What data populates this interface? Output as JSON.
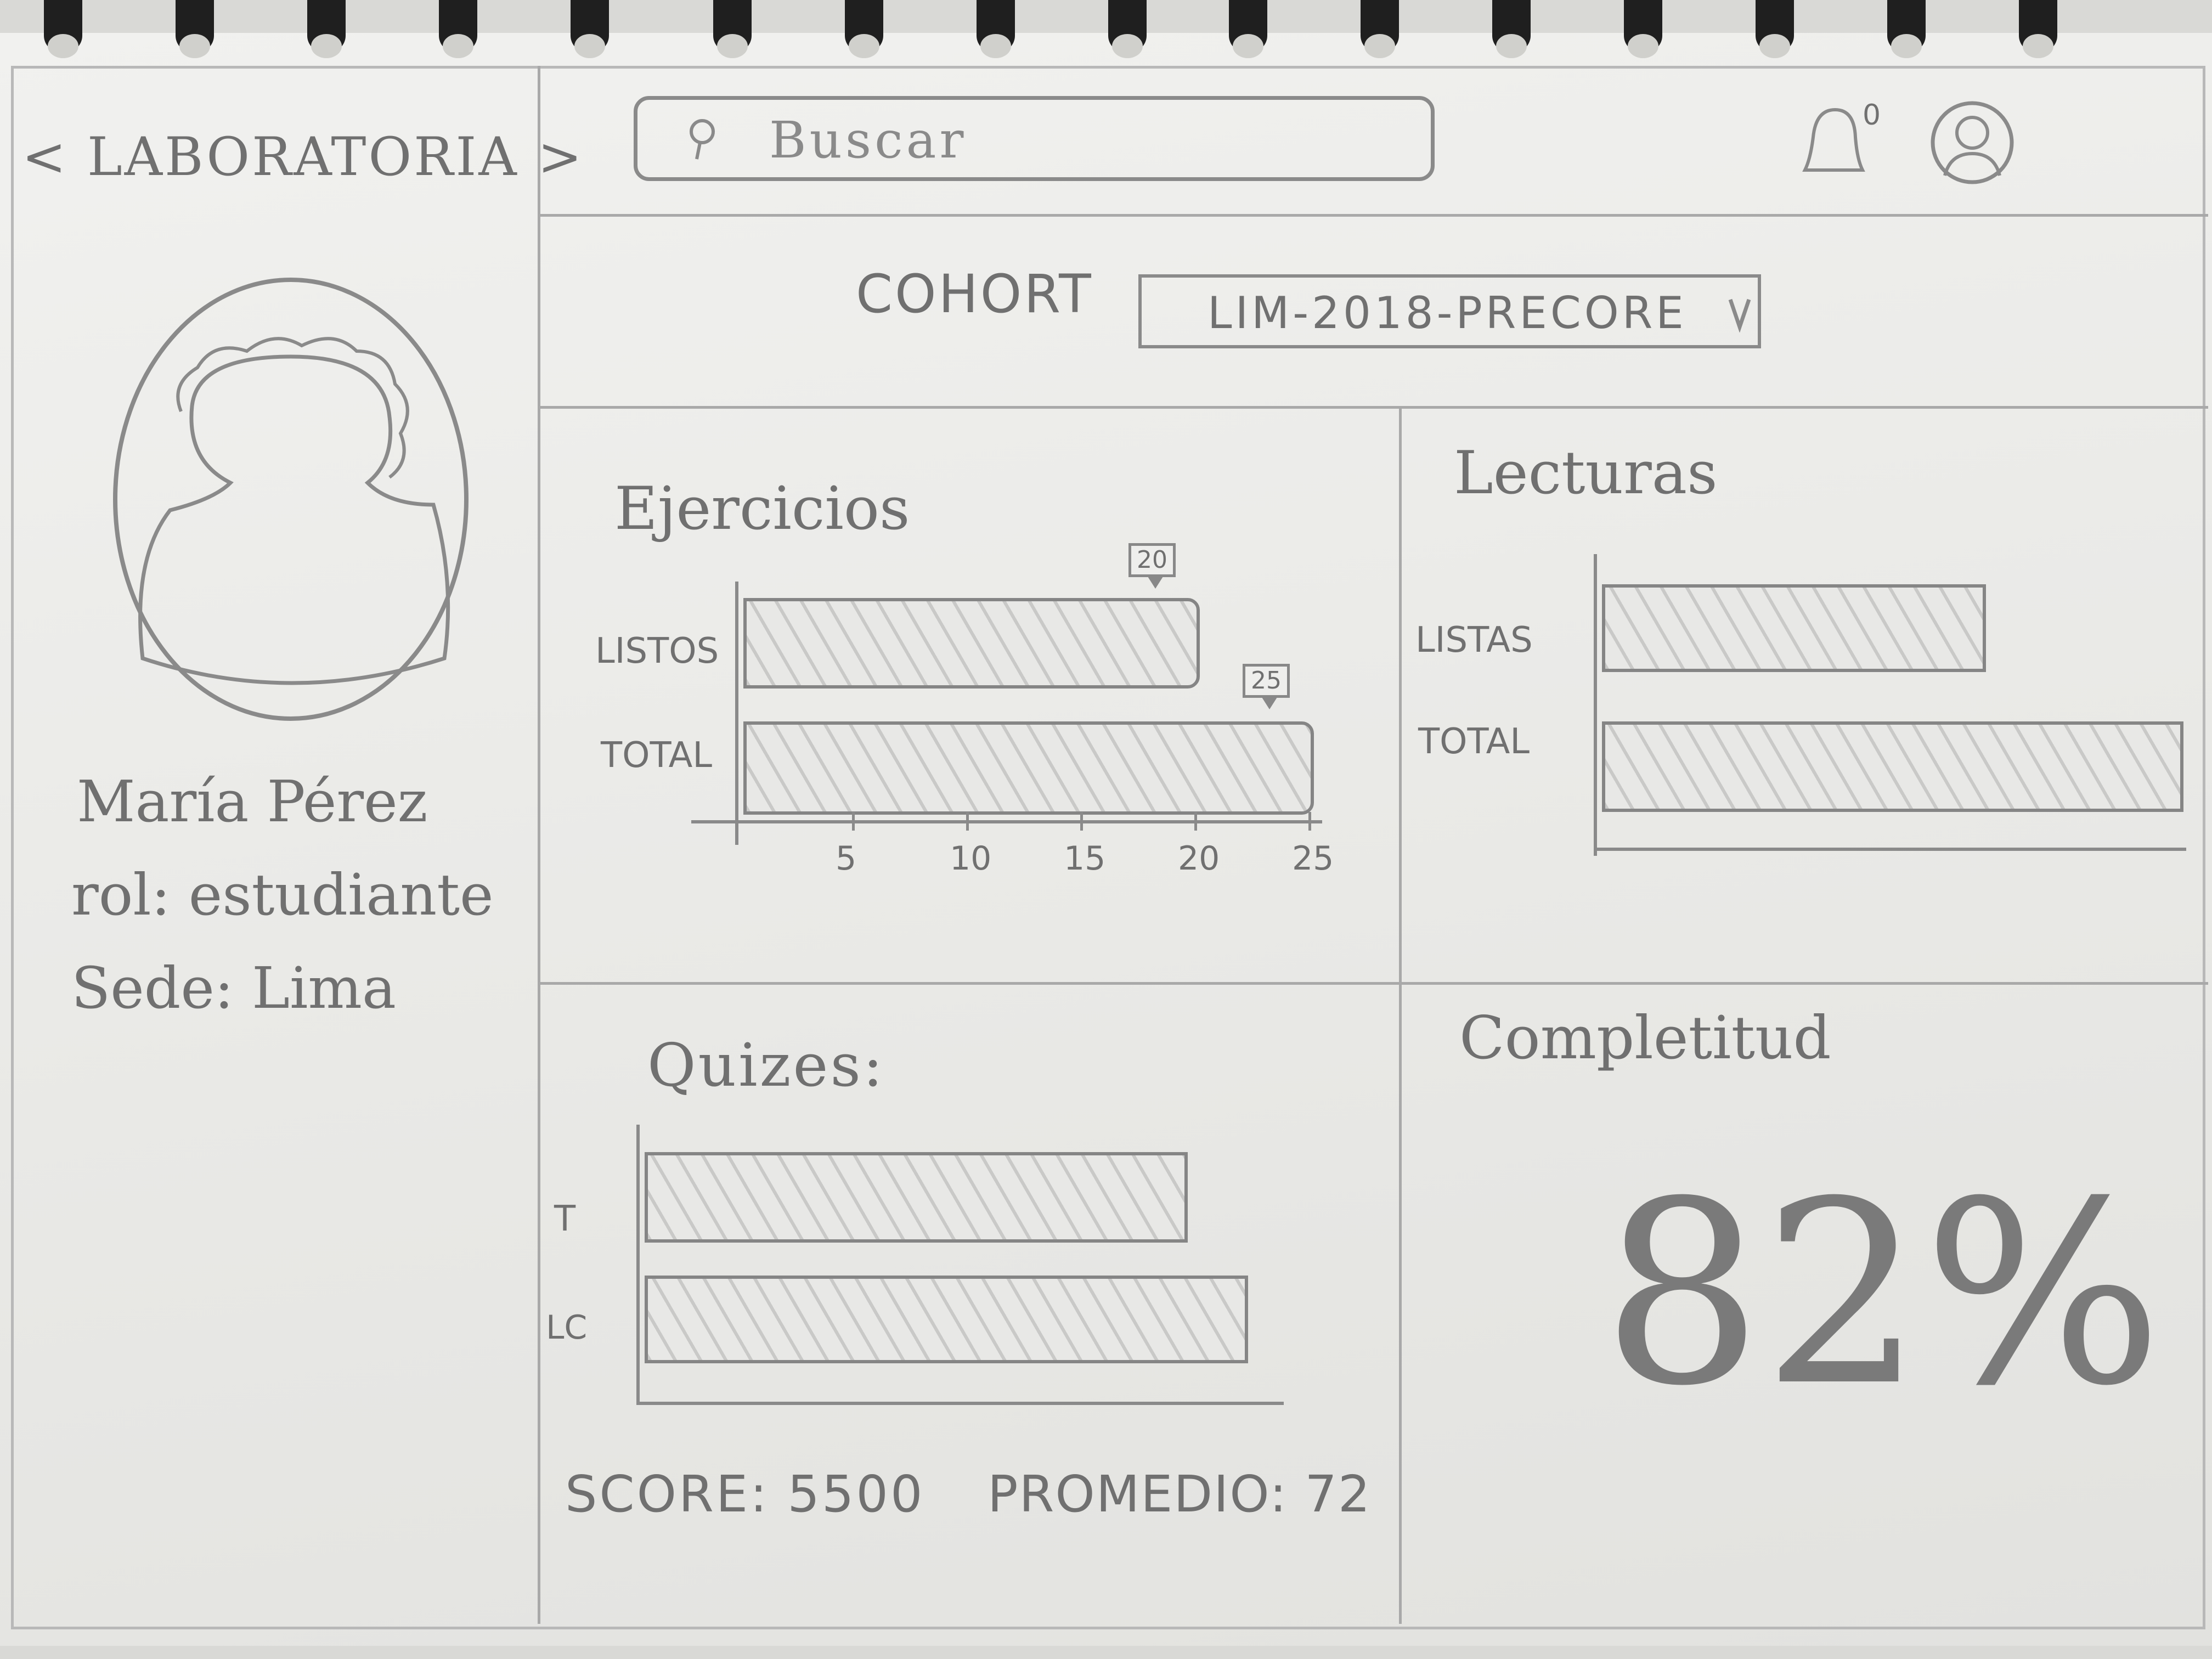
{
  "sidebar": {
    "logo": "< LABORATORIA >",
    "user_name": "María Pérez",
    "user_role": "rol: estudiante",
    "user_sede": "Sede: Lima"
  },
  "topbar": {
    "search_placeholder": "Buscar",
    "notification_count": "0"
  },
  "cohort": {
    "label": "COHORT",
    "selected": "LIM-2018-PRECORE"
  },
  "ejercicios": {
    "title": "Ejercicios",
    "rows": [
      {
        "label": "LISTOS",
        "value": 20
      },
      {
        "label": "TOTAL",
        "value": 25
      }
    ],
    "ticks": [
      "5",
      "10",
      "15",
      "20",
      "25"
    ],
    "xmax": 25
  },
  "lecturas": {
    "title": "Lecturas",
    "rows": [
      {
        "label": "LISTAS",
        "value": 0.66
      },
      {
        "label": "TOTAL",
        "value": 1.0
      }
    ]
  },
  "quizzes": {
    "title": "Quizes:",
    "rows": [
      {
        "label": "T",
        "value": 0.9
      },
      {
        "label": "LC",
        "value": 1.0
      }
    ],
    "score": "SCORE: 5500",
    "promedio": "PROMEDIO: 72"
  },
  "completitud": {
    "title": "Completitud",
    "value": "82%"
  }
}
